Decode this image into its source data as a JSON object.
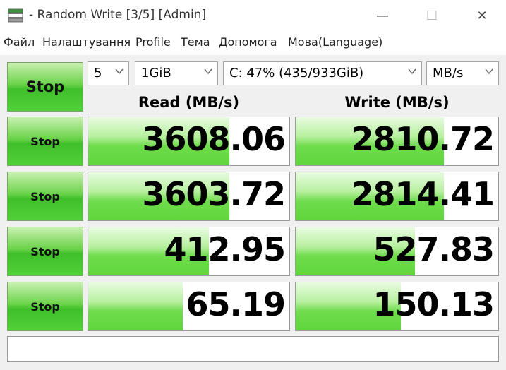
{
  "window": {
    "title": "- Random Write [3/5] [Admin]",
    "min_glyph": "—",
    "max_glyph": "☐",
    "close_glyph": "✕"
  },
  "menu": [
    "Файл",
    "Налаштування",
    "Profile",
    "Тема",
    "Допомога",
    "Мова(Language)"
  ],
  "toolbar": {
    "all_button_label": "Stop",
    "count": "5",
    "size": "1GiB",
    "drive": "C: 47% (435/933GiB)",
    "unit": "MB/s"
  },
  "headers": {
    "read": "Read (MB/s)",
    "write": "Write (MB/s)"
  },
  "rows": [
    {
      "button_label": "Stop",
      "read": "3608.06",
      "write": "2810.72",
      "read_fill": 0.7,
      "write_fill": 0.73
    },
    {
      "button_label": "Stop",
      "read": "3603.72",
      "write": "2814.41",
      "read_fill": 0.7,
      "write_fill": 0.73
    },
    {
      "button_label": "Stop",
      "read": "412.95",
      "write": "527.83",
      "read_fill": 0.6,
      "write_fill": 0.59
    },
    {
      "button_label": "Stop",
      "read": "65.19",
      "write": "150.13",
      "read_fill": 0.47,
      "write_fill": 0.52
    }
  ],
  "comment": ""
}
